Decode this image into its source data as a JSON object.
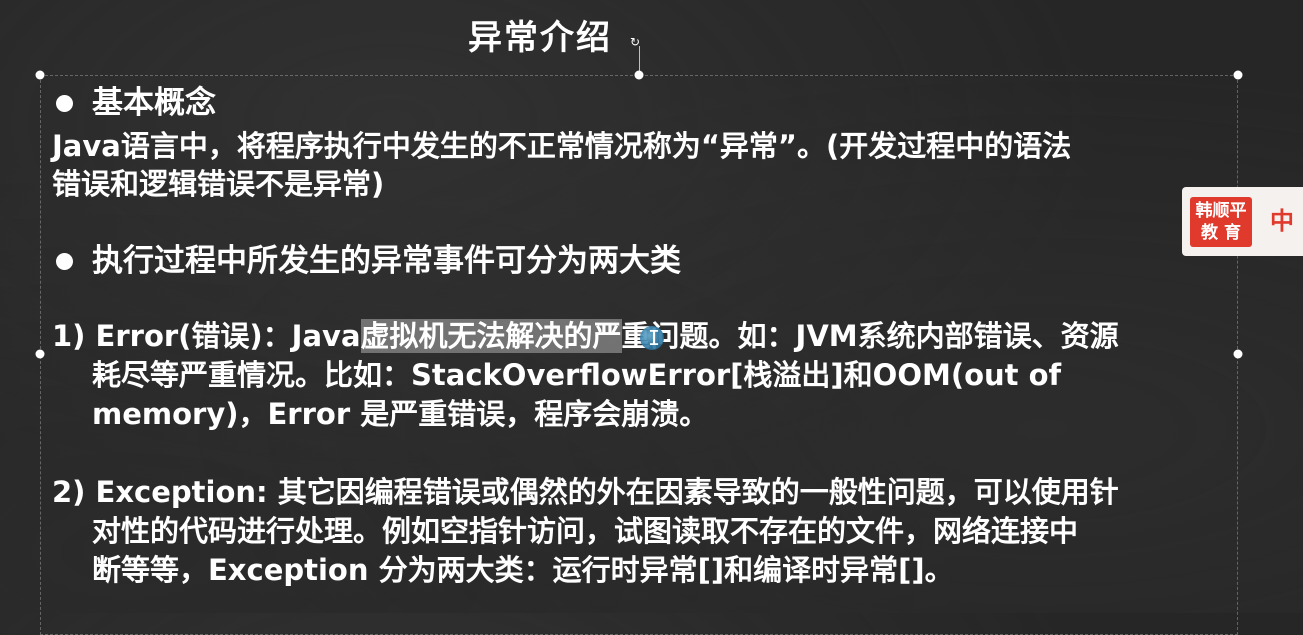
{
  "slide": {
    "title": "异常介绍",
    "rotate_glyph": "↻",
    "section1": {
      "heading": "基本概念",
      "line1": "Java语言中，将程序执行中发生的不正常情况称为“异常”。(开发过程中的语法",
      "line2": "错误和逻辑错误不是异常)"
    },
    "section2": {
      "heading": "执行过程中所发生的异常事件可分为两大类"
    },
    "item1": {
      "line1_prefix": "1) Error(错误)：Java",
      "line1_highlight": "虚拟机无法解决的严",
      "line1_suffix": "重问题。如：JVM系统内部错误、资源",
      "line2": "耗尽等严重情况。比如：StackOverflowError[栈溢出]和OOM(out of",
      "line3": "memory)，Error 是严重错误，程序会崩溃。"
    },
    "item2": {
      "line1": "2) Exception: 其它因编程错误或偶然的外在因素导致的一般性问题，可以使用针",
      "line2": "对性的代码进行处理。例如空指针访问，试图读取不存在的文件，网络连接中",
      "line3": "断等等，Exception 分为两大类：运行时异常[]和编译时异常[]。"
    }
  },
  "badge": {
    "line1": "韩顺平",
    "line2": "教 育",
    "side_text": "中"
  },
  "colors": {
    "background": "#262626",
    "text": "#ffffff",
    "badge_red": "#e03a2c",
    "badge_bg": "#f4f1ee"
  },
  "icons": {
    "bullet": "filled-circle",
    "rotate_handle": "rotate-icon",
    "cursor": "text-cursor-icon"
  }
}
